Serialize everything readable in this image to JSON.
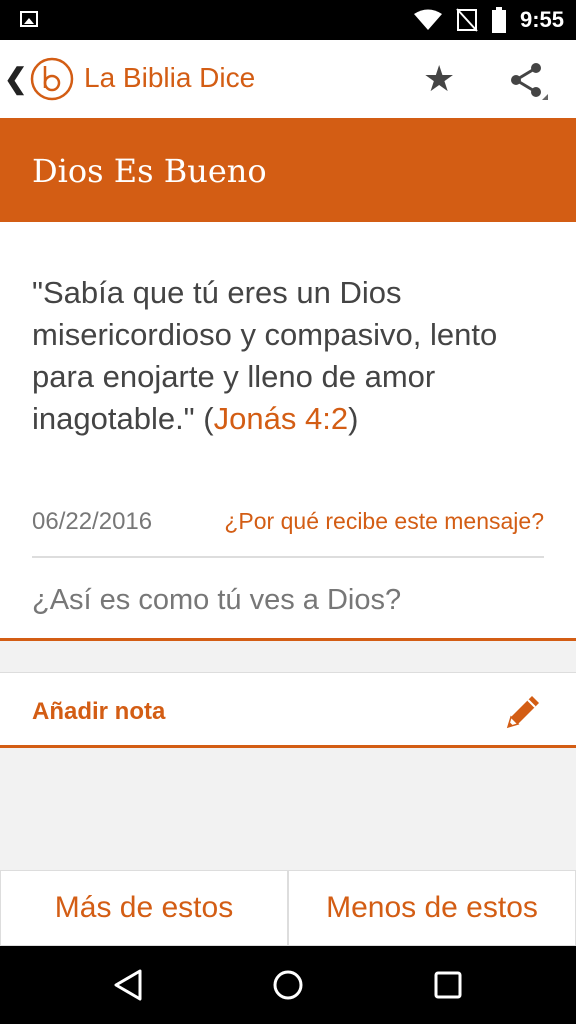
{
  "status_bar": {
    "time": "9:55"
  },
  "app_bar": {
    "title": "La Biblia Dice",
    "accent": "#d35d14"
  },
  "heading": {
    "title": "Dios Es Bueno"
  },
  "verse": {
    "text": "\"Sabía que tú eres un Dios misericordioso y compasivo, lento para enojarte y lleno de amor inagotable.\" (",
    "reference": "Jonás 4:2",
    "close": ")"
  },
  "meta": {
    "date": "06/22/2016",
    "why_link": "¿Por qué recibe este mensaje?"
  },
  "question": "¿Así es como tú ves a Dios?",
  "note": {
    "label": "Añadir nota"
  },
  "buttons": {
    "more": "Más de estos",
    "less": "Menos de estos"
  }
}
